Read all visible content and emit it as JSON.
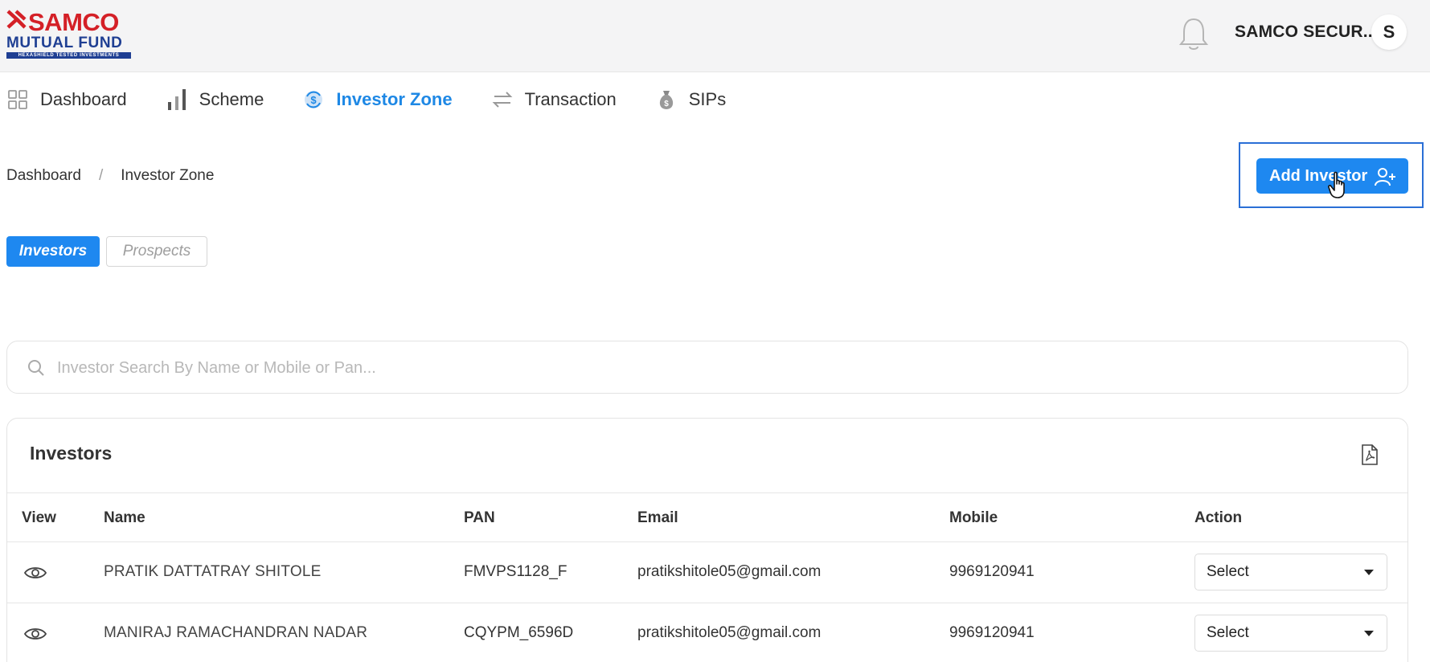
{
  "brand": {
    "name": "SAMCO",
    "line2": "MUTUAL FUND",
    "tagline": "HEXASHIELD TESTED INVESTMENTS",
    "colors": {
      "red": "#d42027",
      "blue": "#1f3f93"
    }
  },
  "header": {
    "bell_icon": "bell-icon",
    "user_name": "SAMCO SECUR...",
    "avatar_letter": "S"
  },
  "nav": {
    "items": [
      {
        "label": "Dashboard",
        "icon": "grid-icon",
        "active": false
      },
      {
        "label": "Scheme",
        "icon": "bar-chart-icon",
        "active": false
      },
      {
        "label": "Investor Zone",
        "icon": "investor-zone-icon",
        "active": true
      },
      {
        "label": "Transaction",
        "icon": "transfer-arrows-icon",
        "active": false
      },
      {
        "label": "SIPs",
        "icon": "money-bag-icon",
        "active": false
      }
    ],
    "active_color": "#1e88e5"
  },
  "breadcrumb": {
    "items": [
      "Dashboard",
      "Investor Zone"
    ],
    "separator": "/"
  },
  "actions": {
    "add_investor_label": "Add Investor",
    "add_investor_icon": "add-user-icon"
  },
  "tabs": [
    {
      "label": "Investors",
      "active": true
    },
    {
      "label": "Prospects",
      "active": false
    }
  ],
  "search": {
    "placeholder": "Investor Search By Name or Mobile or Pan...",
    "value": ""
  },
  "table": {
    "title": "Investors",
    "export_icon": "pdf-file-icon",
    "columns": [
      "View",
      "Name",
      "PAN",
      "Email",
      "Mobile",
      "Action"
    ],
    "rows": [
      {
        "name": "PRATIK DATTATRAY SHITOLE",
        "pan": "FMVPS1128_F",
        "email": "pratikshitole05@gmail.com",
        "mobile": "9969120941",
        "action": "Select"
      },
      {
        "name": "MANIRAJ RAMACHANDRAN NADAR",
        "pan": "CQYPM_6596D",
        "email": "pratikshitole05@gmail.com",
        "mobile": "9969120941",
        "action": "Select"
      }
    ]
  }
}
